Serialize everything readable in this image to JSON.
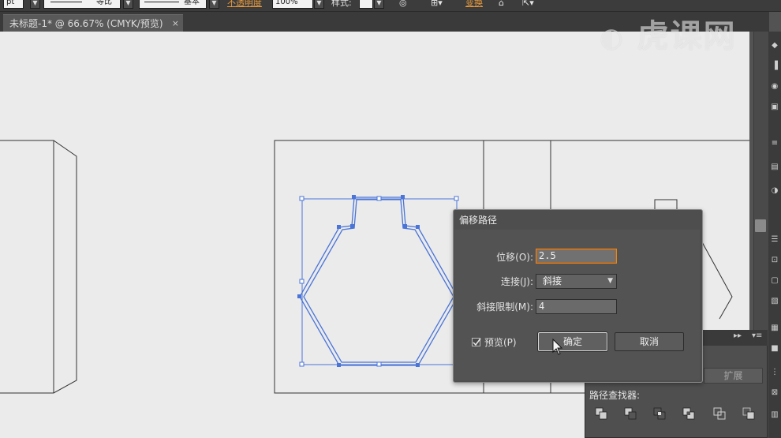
{
  "control_bar": {
    "unit_value": "pt",
    "stroke_profile_label": "等比",
    "brush_label": "基本",
    "opacity_link": "不透明度",
    "opacity_value": "100%",
    "style_label": "样式:",
    "transform_link": "变换"
  },
  "document_tab": {
    "title": "未标题-1* @ 66.67% (CMYK/预览)",
    "close_glyph": "×"
  },
  "watermark": {
    "text": "虎课网"
  },
  "offset_path_dialog": {
    "title": "偏移路径",
    "offset_label": "位移(O):",
    "offset_value": "2.5",
    "join_label": "连接(J):",
    "join_value": "斜接",
    "miter_label": "斜接限制(M):",
    "miter_value": "4",
    "preview_label": "预览(P)",
    "preview_checked": true,
    "ok_label": "确定",
    "cancel_label": "取消"
  },
  "pathfinder_panel": {
    "title": "路径查找器:",
    "expand_label": "扩展",
    "menu_glyph": "▸▸",
    "icons": [
      "unite-icon",
      "minus-front-icon",
      "intersect-icon",
      "exclude-icon",
      "divide-icon",
      "trim-icon"
    ]
  },
  "colors": {
    "accent": "#e0892a",
    "selection": "#4a74d8",
    "canvas": "#ebebeb",
    "ui_dark": "#3c3c3c"
  }
}
